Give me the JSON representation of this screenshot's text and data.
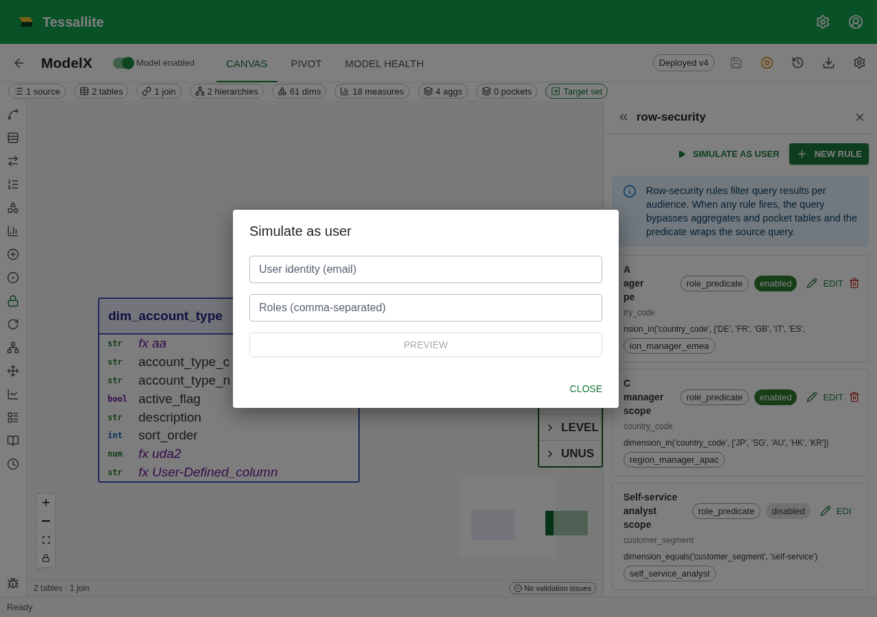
{
  "app_bar": {
    "title": "Tessallite"
  },
  "header": {
    "title": "ModelX",
    "model_toggle": {
      "label": "Model enabled",
      "on": true
    },
    "tabs": [
      {
        "label": "CANVAS",
        "selected": true
      },
      {
        "label": "PIVOT",
        "selected": false
      },
      {
        "label": "MODEL HEALTH",
        "selected": false
      }
    ],
    "deployed": "Deployed v4"
  },
  "summary_chips": [
    {
      "label": "1 source",
      "kind": "stat"
    },
    {
      "label": "2 tables",
      "kind": "stat"
    },
    {
      "label": "1 join",
      "kind": "stat"
    },
    {
      "label": "2 hierarchies",
      "kind": "stat"
    },
    {
      "label": "61 dims",
      "kind": "stat"
    },
    {
      "label": "18 measures",
      "kind": "stat"
    },
    {
      "label": "4 aggs",
      "kind": "stat"
    },
    {
      "label": "0 pockets",
      "kind": "stat"
    },
    {
      "label": "Target set",
      "kind": "action"
    }
  ],
  "rail_items": [
    {
      "selected": false
    },
    {
      "selected": false
    },
    {
      "selected": false
    },
    {
      "selected": false
    },
    {
      "selected": false
    },
    {
      "selected": false
    },
    {
      "selected": false
    },
    {
      "selected": false
    },
    {
      "selected": true
    },
    {
      "selected": false
    },
    {
      "selected": false
    },
    {
      "selected": false
    },
    {
      "selected": false
    },
    {
      "selected": false
    },
    {
      "selected": false
    },
    {
      "selected": false
    }
  ],
  "canvas": {
    "table": {
      "title": "dim_account_type",
      "fields": [
        {
          "type": "str",
          "name": "fx aa",
          "computed": true,
          "kind": "text"
        },
        {
          "type": "str",
          "name": "account_type_c",
          "computed": false,
          "kind": "text"
        },
        {
          "type": "str",
          "name": "account_type_n",
          "computed": false,
          "kind": "text"
        },
        {
          "type": "bool",
          "name": "active_flag",
          "computed": false,
          "kind": "boolean"
        },
        {
          "type": "str",
          "name": "description",
          "computed": false,
          "kind": "text"
        },
        {
          "type": "int",
          "name": "sort_order",
          "computed": false,
          "kind": "integer"
        },
        {
          "type": "num",
          "name": "fx uda2",
          "computed": true,
          "kind": "number"
        },
        {
          "type": "str",
          "name": "fx User-Defined_column",
          "computed": true,
          "kind": "text"
        }
      ]
    },
    "side_node": {
      "rows": [
        "LEVEL",
        "UNUS"
      ]
    },
    "footer": {
      "summary": "2 tables · 1 join",
      "validation": "No validation issues"
    }
  },
  "panel": {
    "title": "row-security",
    "simulate": "SIMULATE AS USER",
    "new_rule": "NEW RULE",
    "info": "Row-security rules filter query results per audience. When any rule fires, the query bypasses aggregates and pocket tables and the predicate wraps the source query.",
    "rules": [
      {
        "title": "A\nager\npe",
        "type": "role_predicate",
        "status": "enabled",
        "enabled": true,
        "edit": "EDIT",
        "has_delete": true,
        "dimension": "try_code",
        "expression": "nsion_in('country_code', ['DE', 'FR', 'GB', 'IT', 'ES',",
        "roles": [
          "ion_manager_emea"
        ]
      },
      {
        "title": "C\nmanager\nscope",
        "type": "role_predicate",
        "status": "enabled",
        "enabled": true,
        "edit": "EDIT",
        "has_delete": true,
        "dimension": "country_code",
        "expression": "dimension_in('country_code', ['JP', 'SG', 'AU', 'HK', 'KR'])",
        "roles": [
          "region_manager_apac"
        ]
      },
      {
        "title": "Self-service\nanalyst scope",
        "type": "role_predicate",
        "status": "disabled",
        "enabled": false,
        "edit": "EDI",
        "has_delete": false,
        "dimension": "customer_segment",
        "expression": "dimension_equals('customer_segment', 'self-service')",
        "roles": [
          "self_service_analyst"
        ]
      }
    ]
  },
  "dialog": {
    "title": "Simulate as user",
    "fields": [
      {
        "placeholder": "User identity (email)"
      },
      {
        "placeholder": "Roles (comma-separated)"
      }
    ],
    "preview": {
      "label": "PREVIEW",
      "disabled": true
    },
    "close": "CLOSE"
  },
  "status_bar": "Ready"
}
